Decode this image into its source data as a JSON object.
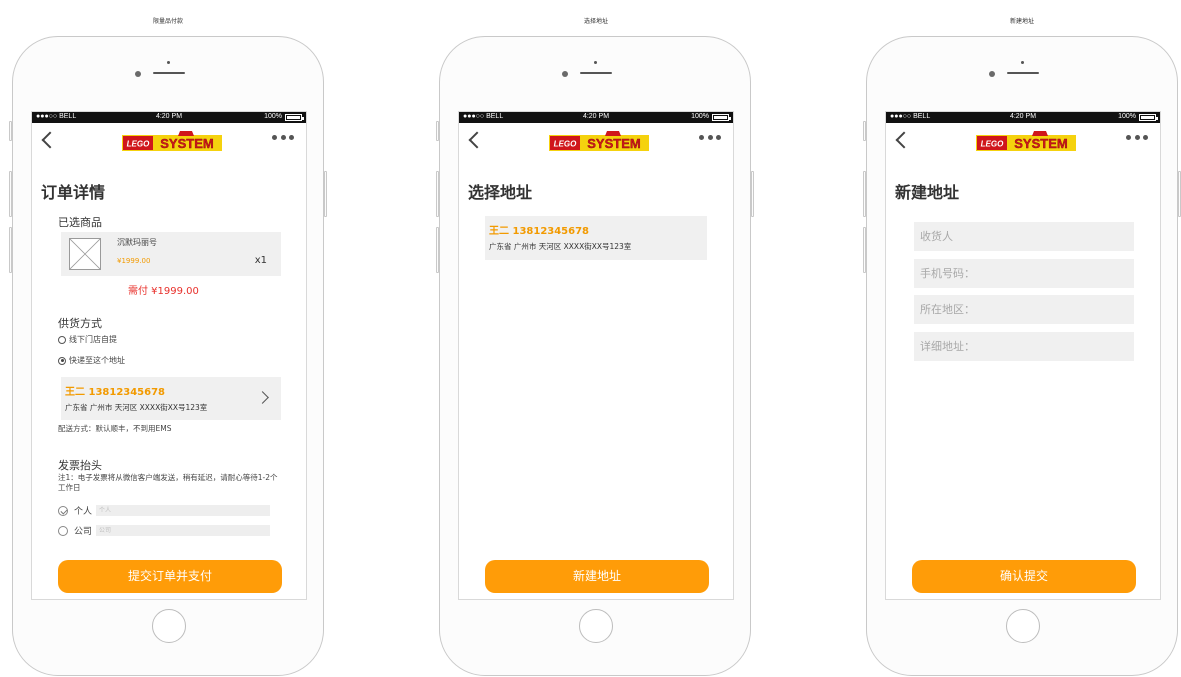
{
  "screens": [
    {
      "label": "限量品付款",
      "title": "订单详情",
      "selected_products_label": "已选商品",
      "product": {
        "name": "沉默玛丽号",
        "price": "¥1999.00",
        "qty": "x1"
      },
      "total": "需付 ¥1999.00",
      "supply_label": "供货方式",
      "supply_options": [
        {
          "label": "线下门店自提",
          "checked": false
        },
        {
          "label": "快递至这个地址",
          "checked": true
        }
      ],
      "address": {
        "name_phone": "王二  13812345678",
        "detail": "广东省 广州市 天河区 XXXX街XX号123室"
      },
      "delivery_note": "配送方式：默认顺丰，不到用EMS",
      "invoice_label": "发票抬头",
      "invoice_note": "注1：电子发票将从微信客户端发送，稍有延迟，请耐心等待1-2个工作日",
      "invoice_options": [
        {
          "label": "个人",
          "placeholder": "个人",
          "checked": true
        },
        {
          "label": "公司",
          "placeholder": "公司",
          "checked": false
        }
      ],
      "submit_label": "提交订单并支付"
    },
    {
      "label": "选择地址",
      "title": "选择地址",
      "address": {
        "name_phone": "王二  13812345678",
        "detail": "广东省 广州市 天河区 XXXX街XX号123室"
      },
      "button_label": "新建地址"
    },
    {
      "label": "新建地址",
      "title": "新建地址",
      "fields": [
        "收货人",
        "手机号码：",
        "所在地区：",
        "详细地址："
      ],
      "button_label": "确认提交"
    }
  ],
  "statusbar": {
    "carrier": "●●●○○ BELL",
    "time": "4:20 PM",
    "battery": "100%"
  },
  "logo": {
    "brand": "LEGO",
    "word": "SYSTEM"
  },
  "colors": {
    "accent": "#ff9c08",
    "price": "#f29a00",
    "total": "#e8302b",
    "logo_red": "#d0161b",
    "logo_yellow": "#f5d20e"
  }
}
